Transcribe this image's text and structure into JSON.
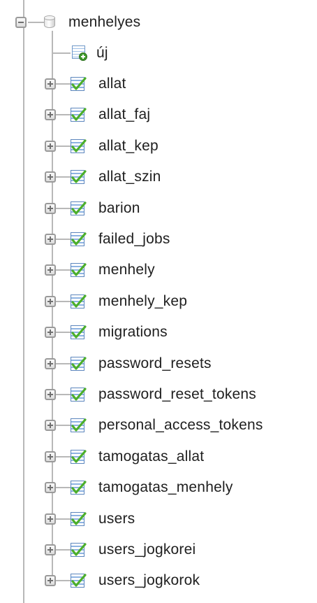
{
  "database": {
    "name": "menhelyes",
    "new_label": "új"
  },
  "tables": [
    {
      "name": "allat"
    },
    {
      "name": "allat_faj"
    },
    {
      "name": "allat_kep"
    },
    {
      "name": "allat_szin"
    },
    {
      "name": "barion"
    },
    {
      "name": "failed_jobs"
    },
    {
      "name": "menhely"
    },
    {
      "name": "menhely_kep"
    },
    {
      "name": "migrations"
    },
    {
      "name": "password_resets"
    },
    {
      "name": "password_reset_tokens"
    },
    {
      "name": "personal_access_tokens"
    },
    {
      "name": "tamogatas_allat"
    },
    {
      "name": "tamogatas_menhely"
    },
    {
      "name": "users"
    },
    {
      "name": "users_jogkorei"
    },
    {
      "name": "users_jogkorok"
    }
  ],
  "icons": {
    "collapse": "minus-box-icon",
    "expand": "plus-box-icon",
    "database": "database-icon",
    "new": "new-table-icon",
    "table": "table-icon"
  },
  "colors": {
    "tree_line": "#b8b8b8",
    "text": "#1f1f1f",
    "table_icon_blue": "#8db3e2",
    "check_green": "#4caf2a"
  }
}
